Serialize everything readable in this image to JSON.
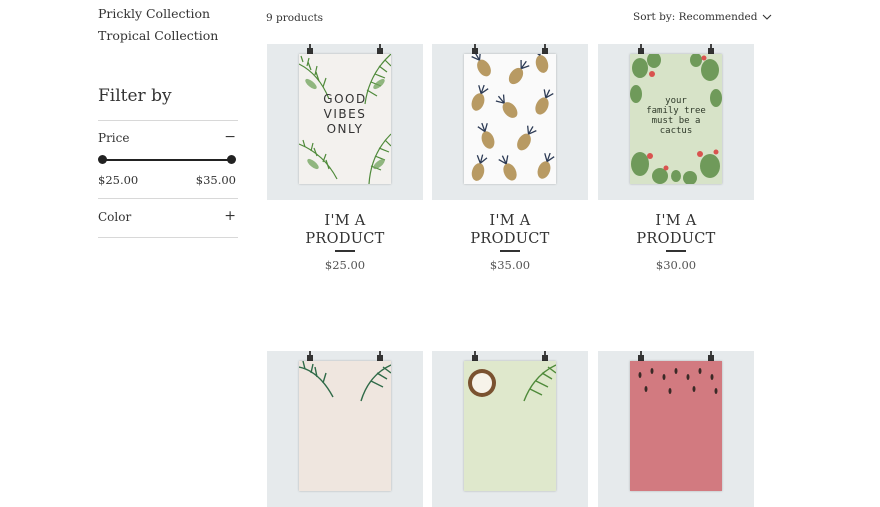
{
  "sidebar": {
    "collections": [
      "Prickly Collection",
      "Tropical Collection"
    ],
    "filter_title": "Filter by",
    "price_label": "Price",
    "price_toggle": "−",
    "price_min": "$25.00",
    "price_max": "$35.00",
    "color_label": "Color",
    "color_toggle": "+"
  },
  "toolbar": {
    "count": "9 products",
    "sort": "Sort by: Recommended",
    "sort_icon": "chevron-down-icon"
  },
  "products": [
    {
      "name_line1": "I'M A",
      "name_line2": "PRODUCT",
      "price": "$25.00",
      "poster_text": [
        "GOOD",
        "VIBES",
        "ONLY"
      ]
    },
    {
      "name_line1": "I'M A",
      "name_line2": "PRODUCT",
      "price": "$35.00"
    },
    {
      "name_line1": "I'M A",
      "name_line2": "PRODUCT",
      "price": "$30.00",
      "poster_text": [
        "your",
        "family tree",
        "must be a",
        "cactus"
      ]
    },
    {},
    {},
    {}
  ],
  "colors": {
    "image_bg": "#e6eaec",
    "leaf_green": "#4f8a3a",
    "pineapple": "#b89a63",
    "cactus_bg": "#d7e3c8",
    "watermelon": "#d27a80"
  }
}
